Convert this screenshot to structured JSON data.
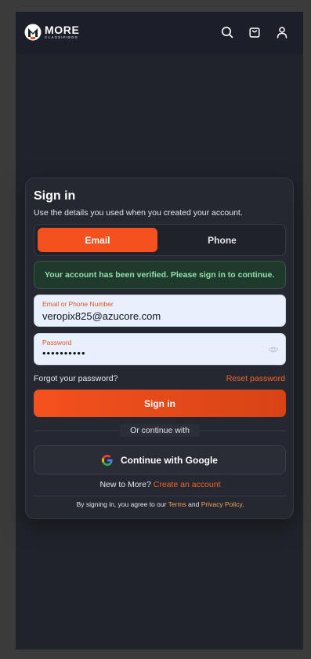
{
  "header": {
    "logo_word": "MORE",
    "logo_sub": "CLASSIFIEDS",
    "icons": [
      "search-icon",
      "shopping-bag-icon",
      "user-icon"
    ]
  },
  "signin": {
    "title": "Sign in",
    "subtitle": "Use the details you used when you created your account.",
    "tabs": [
      {
        "label": "Email",
        "active": true
      },
      {
        "label": "Phone",
        "active": false
      }
    ],
    "alert": "Your account has been verified. Please sign in to continue.",
    "email_field": {
      "label": "Email or Phone Number",
      "value": "veropix825@azucore.com"
    },
    "password_field": {
      "label": "Password",
      "value": "••••••••••"
    },
    "forgot_text": "Forgot your password?",
    "reset_link": "Reset password",
    "submit_label": "Sign in",
    "divider_text": "Or continue with",
    "google_label": "Continue with Google",
    "new_to": "New to More?",
    "create_account": "Create an account",
    "legal_prefix": "By signing in, you agree to our",
    "terms": "Terms",
    "legal_and": "and",
    "privacy": "Privacy Policy",
    "legal_end": "."
  },
  "colors": {
    "accent": "#f4511e",
    "background": "#20232a",
    "card": "#252830",
    "success_text": "#8fe0a9"
  }
}
